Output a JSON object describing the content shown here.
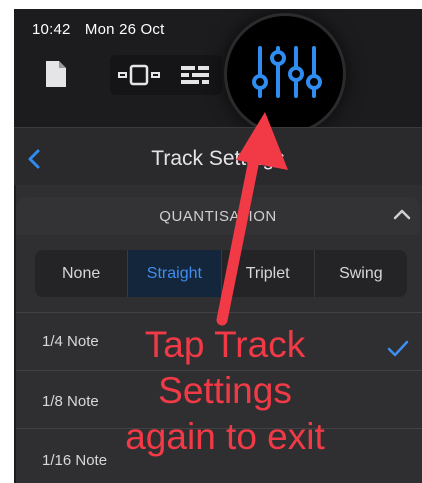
{
  "status_bar": {
    "time": "10:42",
    "date": "Mon 26 Oct"
  },
  "toolbar": {
    "icons": [
      "document-icon",
      "grid-view-icon",
      "list-view-icon",
      "mixer-sliders-icon"
    ]
  },
  "nav": {
    "title": "Track Settings",
    "back_icon": "chevron-left-icon"
  },
  "section": {
    "title": "QUANTISATION",
    "collapse_icon": "chevron-up-icon",
    "segments": [
      "None",
      "Straight",
      "Triplet",
      "Swing"
    ],
    "selected_segment": "Straight",
    "rows": [
      "1/4 Note",
      "1/8 Note",
      "1/16 Note"
    ],
    "checked_row": "1/4 Note"
  },
  "annotation": {
    "lines": [
      "Tap Track",
      "Settings",
      "again to exit"
    ]
  },
  "colors": {
    "accent": "#3f8df0",
    "annotation": "#f23a47",
    "background": "#1c1c1e"
  }
}
